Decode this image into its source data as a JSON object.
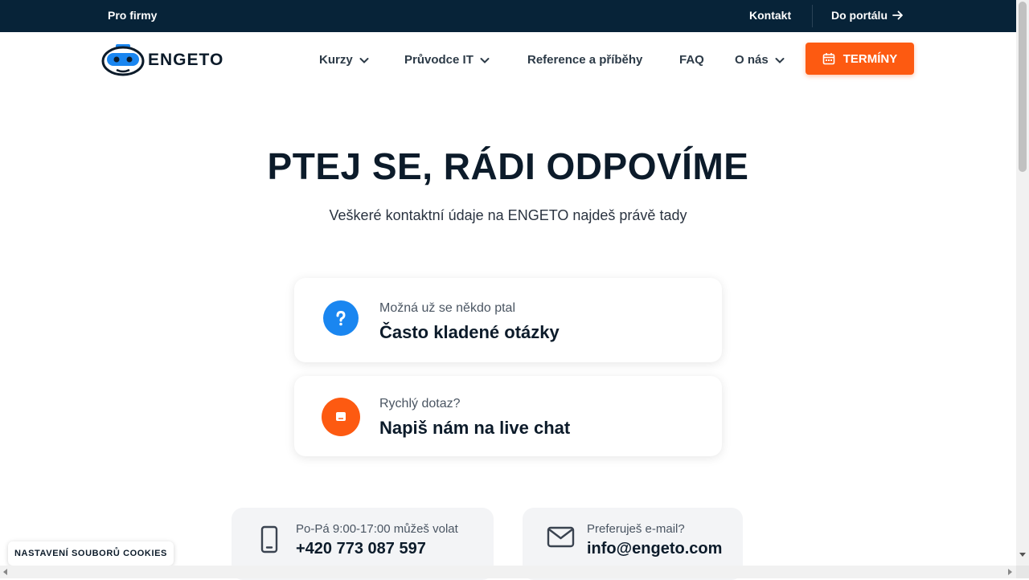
{
  "topbar": {
    "pro_firmy": "Pro firmy",
    "kontakt": "Kontakt",
    "do_portalu": "Do portálu"
  },
  "logo": {
    "text": "ENGETO"
  },
  "nav": {
    "items": [
      {
        "label": "Kurzy",
        "has_dropdown": true
      },
      {
        "label": "Průvodce IT",
        "has_dropdown": true
      },
      {
        "label": "Reference a příběhy",
        "has_dropdown": false
      },
      {
        "label": "FAQ",
        "has_dropdown": false
      },
      {
        "label": "O nás",
        "has_dropdown": true
      }
    ],
    "cta": "TERMÍNY"
  },
  "hero": {
    "title": "PTEJ SE, RÁDI ODPOVÍME",
    "subtitle": "Veškeré kontaktní údaje na ENGETO najdeš právě tady"
  },
  "cards": [
    {
      "small": "Možná už se někdo ptal",
      "big": "Často kladené otázky",
      "icon": "question-icon",
      "color": "#1a86f0"
    },
    {
      "small": "Rychlý dotaz?",
      "big": "Napiš nám na live chat",
      "icon": "chat-icon",
      "color": "#fd5a11"
    }
  ],
  "contacts": [
    {
      "small": "Po-Pá 9:00-17:00 můžeš volat",
      "big": "+420 773 087 597",
      "icon": "phone-icon"
    },
    {
      "small": "Preferuješ e-mail?",
      "big": "info@engeto.com",
      "icon": "envelope-icon"
    }
  ],
  "cookies": {
    "label": "NASTAVENÍ SOUBORŮ COOKIES"
  },
  "colors": {
    "dark": "#072338",
    "accent": "#fd5a11",
    "blue": "#1a86f0"
  }
}
